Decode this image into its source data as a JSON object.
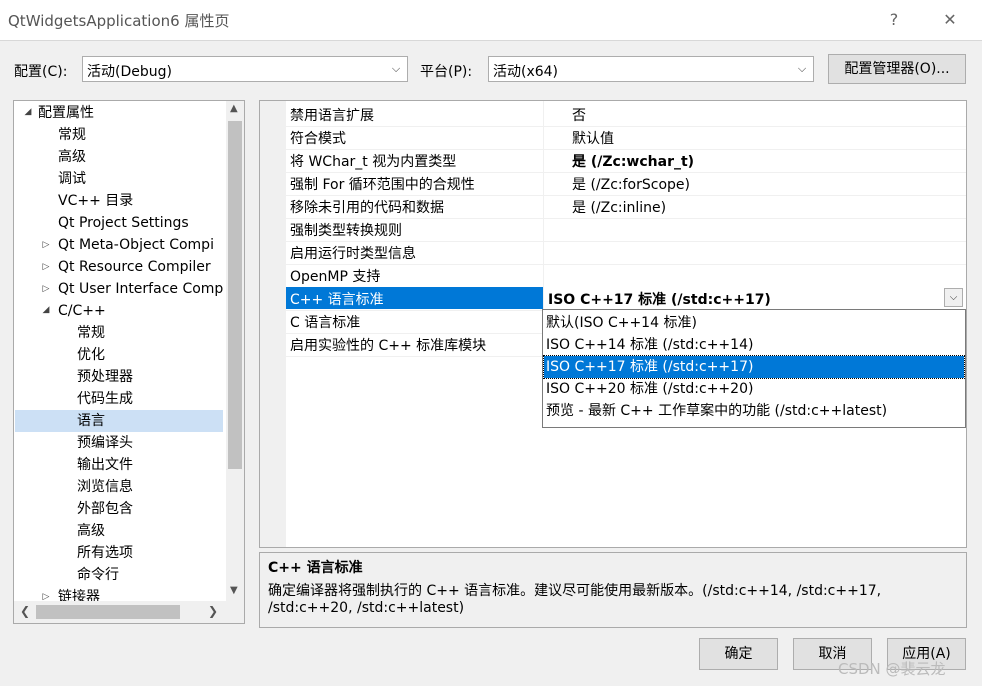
{
  "window": {
    "title": "QtWidgetsApplication6 属性页",
    "help": "?",
    "close": "✕"
  },
  "toolbar": {
    "config_label": "配置(C):",
    "config_value": "活动(Debug)",
    "platform_label": "平台(P):",
    "platform_value": "活动(x64)",
    "config_manager": "配置管理器(O)..."
  },
  "tree": {
    "items": [
      {
        "label": "配置属性"
      },
      {
        "label": "常规"
      },
      {
        "label": "高级"
      },
      {
        "label": "调试"
      },
      {
        "label": "VC++ 目录"
      },
      {
        "label": "Qt Project Settings"
      },
      {
        "label": "Qt Meta-Object Compi"
      },
      {
        "label": "Qt Resource Compiler"
      },
      {
        "label": "Qt User Interface Comp"
      },
      {
        "label": "C/C++"
      },
      {
        "label": "常规"
      },
      {
        "label": "优化"
      },
      {
        "label": "预处理器"
      },
      {
        "label": "代码生成"
      },
      {
        "label": "语言"
      },
      {
        "label": "预编译头"
      },
      {
        "label": "输出文件"
      },
      {
        "label": "浏览信息"
      },
      {
        "label": "外部包含"
      },
      {
        "label": "高级"
      },
      {
        "label": "所有选项"
      },
      {
        "label": "命令行"
      },
      {
        "label": "链接器"
      }
    ]
  },
  "grid": {
    "rows": [
      {
        "name": "禁用语言扩展",
        "value": "否"
      },
      {
        "name": "符合模式",
        "value": "默认值"
      },
      {
        "name": "将 WChar_t 视为内置类型",
        "value": "是 (/Zc:wchar_t)"
      },
      {
        "name": "强制 For 循环范围中的合规性",
        "value": "是 (/Zc:forScope)"
      },
      {
        "name": "移除未引用的代码和数据",
        "value": "是 (/Zc:inline)"
      },
      {
        "name": "强制类型转换规则",
        "value": ""
      },
      {
        "name": "启用运行时类型信息",
        "value": ""
      },
      {
        "name": "OpenMP 支持",
        "value": ""
      },
      {
        "name": "C++ 语言标准",
        "value": "ISO C++17 标准 (/std:c++17)"
      },
      {
        "name": "C 语言标准",
        "value": ""
      },
      {
        "name": "启用实验性的 C++ 标准库模块",
        "value": ""
      }
    ]
  },
  "dropdown": {
    "options": [
      "默认(ISO C++14 标准)",
      "ISO C++14 标准 (/std:c++14)",
      "ISO C++17 标准 (/std:c++17)",
      "ISO C++20 标准 (/std:c++20)",
      "预览 - 最新 C++ 工作草案中的功能 (/std:c++latest)"
    ]
  },
  "description": {
    "title": "C++ 语言标准",
    "line1": "确定编译器将强制执行的 C++ 语言标准。建议尽可能使用最新版本。(/std:c++14, /std:c++17,",
    "line2": "/std:c++20, /std:c++latest)"
  },
  "buttons": {
    "ok": "确定",
    "cancel": "取消",
    "apply": "应用(A)"
  },
  "watermark": "CSDN @裴云龙",
  "colors": {
    "selection": "#0078d7",
    "tree_selection": "#cce0f5"
  }
}
